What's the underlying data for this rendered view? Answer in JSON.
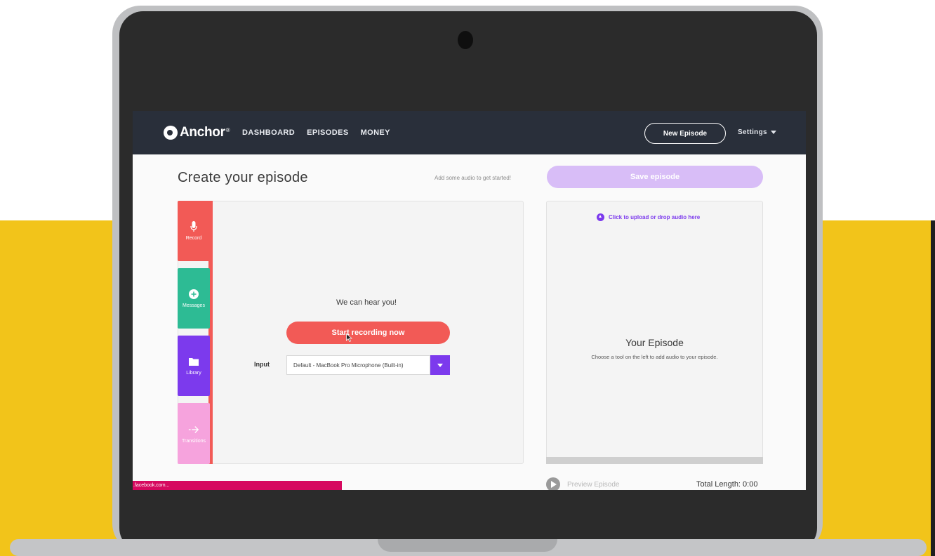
{
  "app": {
    "logo_text": "Anchor",
    "logo_mark": "®"
  },
  "nav": {
    "links": [
      "DASHBOARD",
      "EPISODES",
      "MONEY"
    ],
    "new_episode_label": "New Episode",
    "settings_label": "Settings"
  },
  "header": {
    "title": "Create your episode",
    "hint": "Add some audio to get started!",
    "save_label": "Save episode"
  },
  "tools": [
    {
      "label": "Record",
      "icon": "microphone-icon",
      "color": "#f25a56"
    },
    {
      "label": "Messages",
      "icon": "message-add-icon",
      "color": "#2dbb94"
    },
    {
      "label": "Library",
      "icon": "folder-icon",
      "color": "#7c3aed"
    },
    {
      "label": "Transitions",
      "icon": "arrow-right-icon",
      "color": "#f6a3dd"
    }
  ],
  "record": {
    "status": "We can hear you!",
    "start_label": "Start recording now",
    "input_label": "Input",
    "input_value": "Default - MacBook Pro Microphone (Built-in)"
  },
  "episode": {
    "upload_label": "Click to upload or drop audio here",
    "title": "Your Episode",
    "subtitle": "Choose a tool on the left to add audio to your episode.",
    "preview_label": "Preview Episode",
    "total_length": "Total Length: 0:00"
  },
  "status_bar": {
    "text": ".facebook.com..."
  },
  "colors": {
    "accent_purple": "#7c3aed",
    "record_red": "#f25a56",
    "messages_green": "#2dbb94",
    "transitions_pink": "#f6a3dd",
    "navbar": "#292f3a",
    "background_yellow": "#f2c41a"
  }
}
